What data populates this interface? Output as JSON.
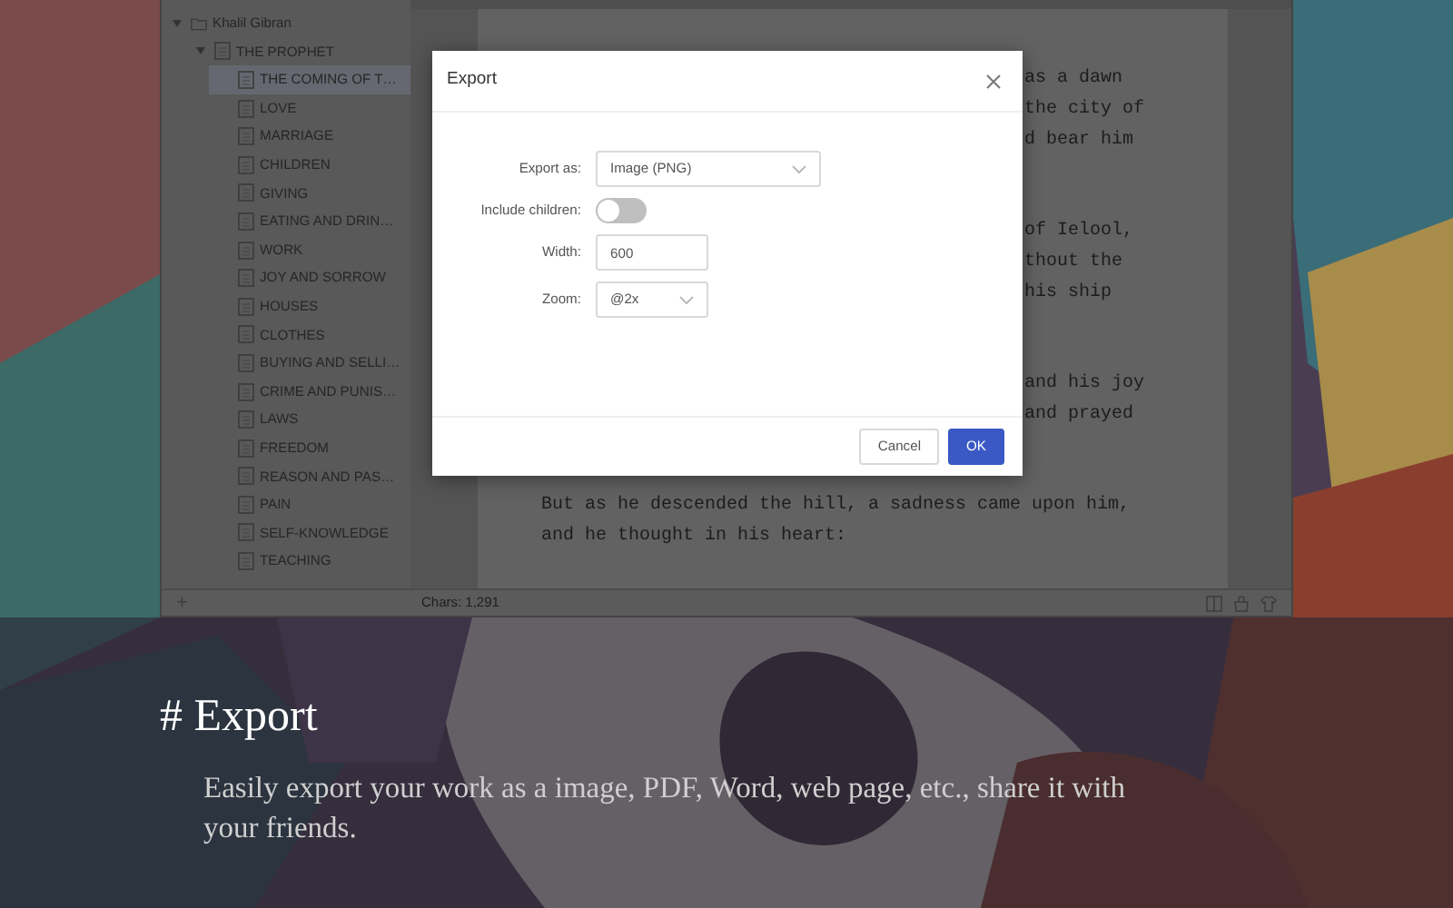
{
  "app": {
    "sidebar": {
      "tree": [
        {
          "label": "Khalil Gibran",
          "kind": "folder",
          "expanded": true,
          "selected": false,
          "children": [
            {
              "label": "THE PROPHET",
              "kind": "document",
              "expanded": true,
              "selected": false,
              "children": [
                {
                  "label": "THE COMING OF T…",
                  "kind": "document",
                  "selected": true
                },
                {
                  "label": "LOVE",
                  "kind": "document",
                  "selected": false
                },
                {
                  "label": "MARRIAGE",
                  "kind": "document",
                  "selected": false
                },
                {
                  "label": "CHILDREN",
                  "kind": "document",
                  "selected": false
                },
                {
                  "label": "GIVING",
                  "kind": "document",
                  "selected": false
                },
                {
                  "label": "EATING AND DRIN…",
                  "kind": "document",
                  "selected": false
                },
                {
                  "label": "WORK",
                  "kind": "document",
                  "selected": false
                },
                {
                  "label": "JOY AND SORROW",
                  "kind": "document",
                  "selected": false
                },
                {
                  "label": "HOUSES",
                  "kind": "document",
                  "selected": false
                },
                {
                  "label": "CLOTHES",
                  "kind": "document",
                  "selected": false
                },
                {
                  "label": "BUYING AND SELLI…",
                  "kind": "document",
                  "selected": false
                },
                {
                  "label": "CRIME AND PUNIS…",
                  "kind": "document",
                  "selected": false
                },
                {
                  "label": "LAWS",
                  "kind": "document",
                  "selected": false
                },
                {
                  "label": "FREEDOM",
                  "kind": "document",
                  "selected": false
                },
                {
                  "label": "REASON AND PAS…",
                  "kind": "document",
                  "selected": false
                },
                {
                  "label": "PAIN",
                  "kind": "document",
                  "selected": false
                },
                {
                  "label": "SELF-KNOWLEDGE",
                  "kind": "document",
                  "selected": false
                },
                {
                  "label": "TEACHING",
                  "kind": "document",
                  "selected": false
                }
              ]
            }
          ]
        }
      ],
      "add_button": "+"
    },
    "editor": {
      "paragraphs": [
        {
          "kind": "fragment",
          "lines": [
            "as a dawn",
            "the city of",
            "d bear him"
          ]
        },
        {
          "kind": "fragment",
          "lines": [
            "of Ielool,",
            "thout the",
            "his ship"
          ]
        },
        {
          "kind": "fragment",
          "lines": [
            "and his joy",
            "and prayed"
          ]
        },
        {
          "kind": "full",
          "lines": [
            "But as he descended the hill, a sadness came upon him,",
            "and he thought in his heart:"
          ]
        }
      ]
    },
    "status_bar": {
      "chars": "Chars: 1,291"
    }
  },
  "dialog": {
    "title": "Export",
    "fields": [
      {
        "kind": "select",
        "label": "Export as:",
        "value": "Image (PNG)"
      },
      {
        "kind": "toggle",
        "label": "Include children:",
        "on": false
      },
      {
        "kind": "input",
        "label": "Width:",
        "value": "600"
      },
      {
        "kind": "select",
        "label": "Zoom:",
        "value": "@2x"
      }
    ],
    "buttons": [
      {
        "label": "Cancel",
        "primary": false
      },
      {
        "label": "OK",
        "primary": true
      }
    ]
  },
  "caption": {
    "heading": "# Export",
    "text": "Easily export your work as a image, PDF, Word, web page, etc., share it with your friends."
  }
}
